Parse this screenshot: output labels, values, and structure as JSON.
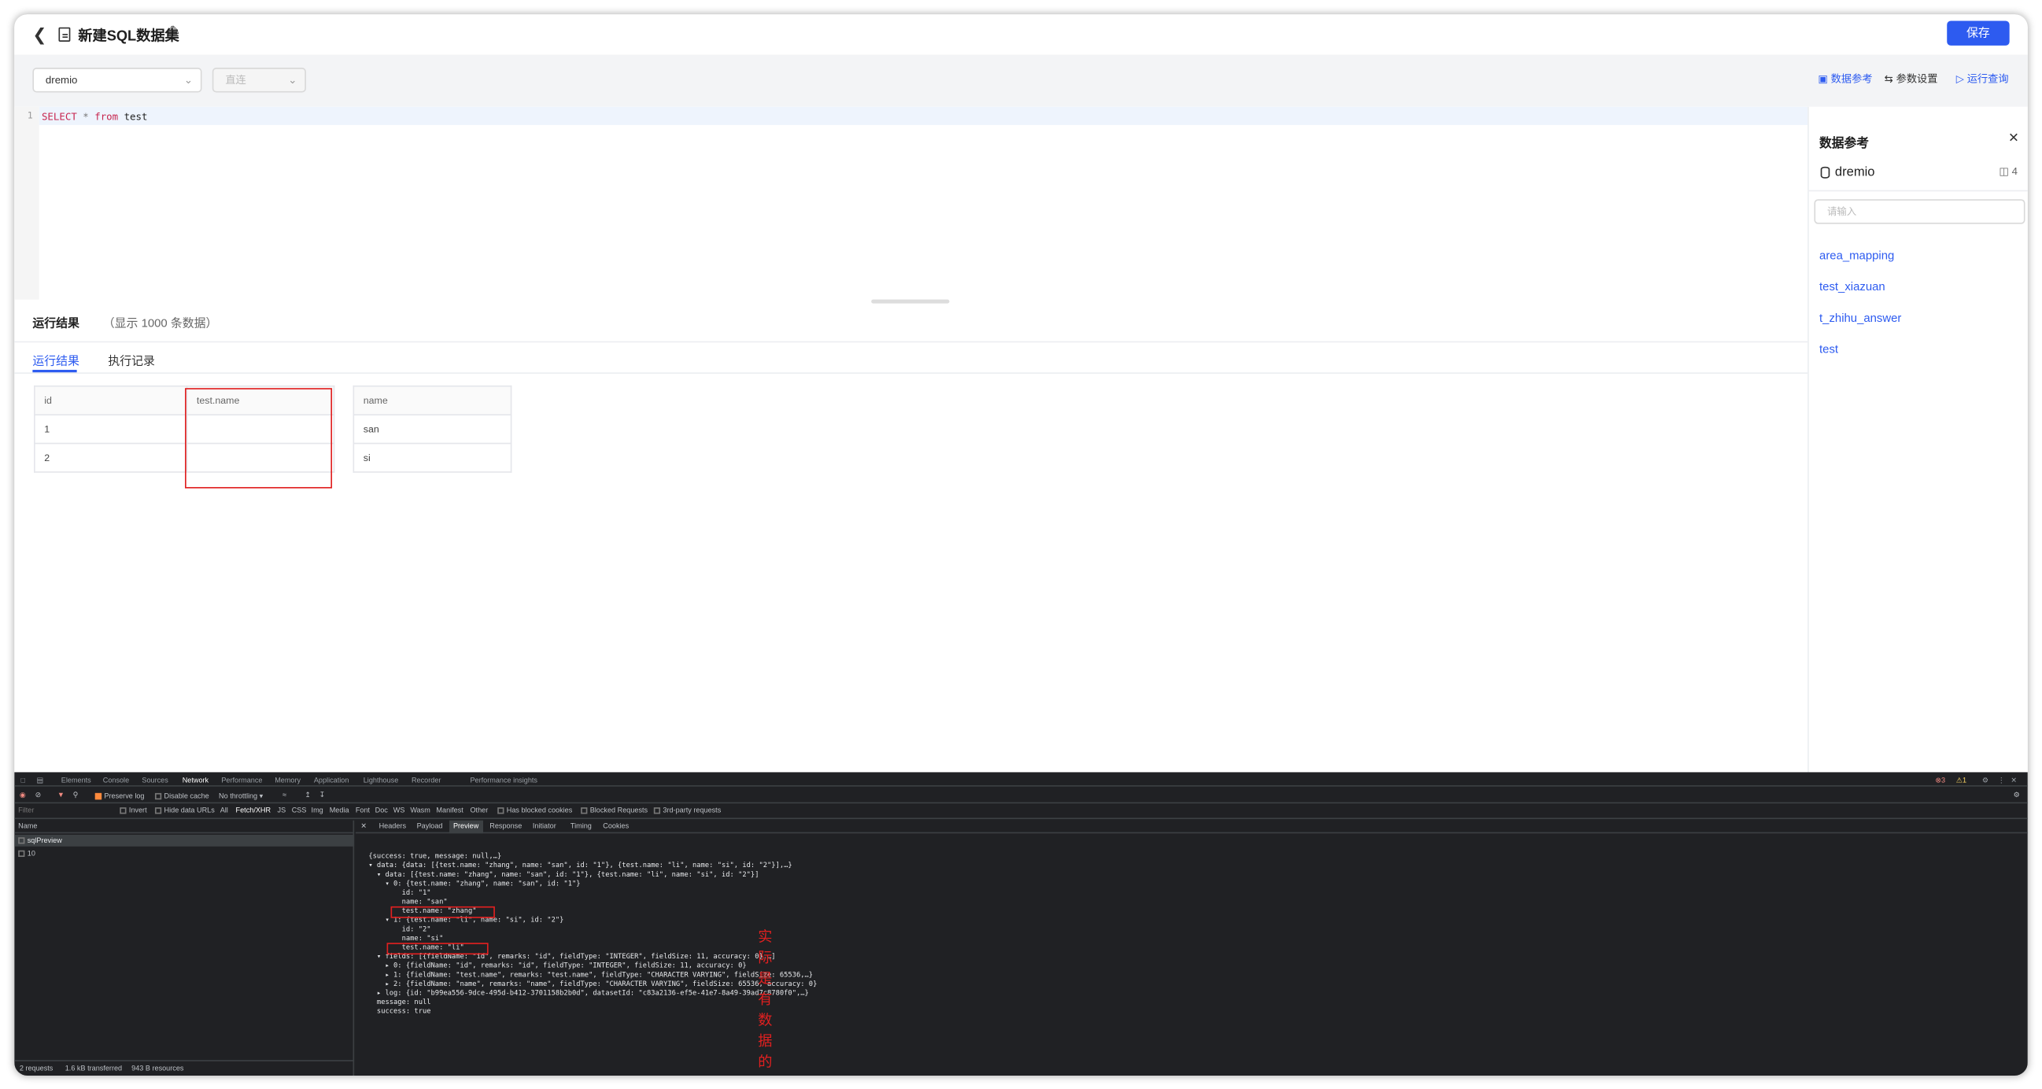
{
  "header": {
    "back_icon": "chevron-left-icon",
    "title": "新建SQL数据集",
    "save_label": "保存"
  },
  "toolbar": {
    "datasource_value": "dremio",
    "mode_value": "直连",
    "links": [
      "数据参考",
      "参数设置",
      "运行查询"
    ]
  },
  "editor": {
    "line_number": "1",
    "code": {
      "kw1": "SELECT",
      "op": "*",
      "kw2": "from",
      "table": "test"
    }
  },
  "results": {
    "title": "运行结果",
    "subtitle": "（显示 1000 条数据）",
    "tabs": [
      "运行结果",
      "执行记录"
    ],
    "columns": [
      "id",
      "test.name",
      "name"
    ],
    "rows": [
      [
        "1",
        "",
        "san"
      ],
      [
        "2",
        "",
        "si"
      ]
    ]
  },
  "ref_panel": {
    "title": "数据参考",
    "db_name": "dremio",
    "table_count": "4",
    "search_placeholder": "请输入",
    "tables": [
      "area_mapping",
      "test_xiazuan",
      "t_zhihu_answer",
      "test"
    ]
  },
  "devtools": {
    "main_tabs": [
      "Elements",
      "Console",
      "Sources",
      "Network",
      "Performance",
      "Memory",
      "Application",
      "Lighthouse",
      "Recorder",
      "Performance insights"
    ],
    "badges": [
      "3",
      "1"
    ],
    "toolbar": {
      "preserve_log": "Preserve log",
      "disable_cache": "Disable cache",
      "throttling": "No throttling"
    },
    "filter_placeholder": "Filter",
    "filters": [
      "Invert",
      "Hide data URLs",
      "All",
      "Fetch/XHR",
      "JS",
      "CSS",
      "Img",
      "Media",
      "Font",
      "Doc",
      "WS",
      "Wasm",
      "Manifest",
      "Other",
      "Has blocked cookies",
      "Blocked Requests",
      "3rd-party requests"
    ],
    "name_header": "Name",
    "requests": [
      "sqlPreview",
      "10"
    ],
    "detail_tabs": [
      "Headers",
      "Payload",
      "Preview",
      "Response",
      "Initiator",
      "Timing",
      "Cookies"
    ],
    "preview_lines": [
      "{success: true, message: null,…}",
      "▾ data: {data: [{test.name: \"zhang\", name: \"san\", id: \"1\"}, {test.name: \"li\", name: \"si\", id: \"2\"}],…}",
      "  ▾ data: [{test.name: \"zhang\", name: \"san\", id: \"1\"}, {test.name: \"li\", name: \"si\", id: \"2\"}]",
      "    ▾ 0: {test.name: \"zhang\", name: \"san\", id: \"1\"}",
      "        id: \"1\"",
      "        name: \"san\"",
      "        test.name: \"zhang\"",
      "    ▾ 1: {test.name: \"li\", name: \"si\", id: \"2\"}",
      "        id: \"2\"",
      "        name: \"si\"",
      "        test.name: \"li\"",
      "  ▾ fields: [{fieldName: \"id\", remarks: \"id\", fieldType: \"INTEGER\", fieldSize: 11, accuracy: 0},…]",
      "    ▸ 0: {fieldName: \"id\", remarks: \"id\", fieldType: \"INTEGER\", fieldSize: 11, accuracy: 0}",
      "    ▸ 1: {fieldName: \"test.name\", remarks: \"test.name\", fieldType: \"CHARACTER VARYING\", fieldSize: 65536,…}",
      "    ▸ 2: {fieldName: \"name\", remarks: \"name\", fieldType: \"CHARACTER VARYING\", fieldSize: 65536, accuracy: 0}",
      "  ▸ log: {id: \"b99ea556-9dce-495d-b412-3701158b2b0d\", datasetId: \"c83a2136-ef5e-41e7-8a49-39ad7c8780f0\",…}",
      "  message: null",
      "  success: true"
    ],
    "annotation": "实际是有数据的",
    "status_bar": [
      "2 requests",
      "1.6 kB transferred",
      "943 B resources"
    ]
  },
  "colors": {
    "primary": "#2d5bf0",
    "annotation_red": "#e02020",
    "devtools_bg": "#202124"
  }
}
